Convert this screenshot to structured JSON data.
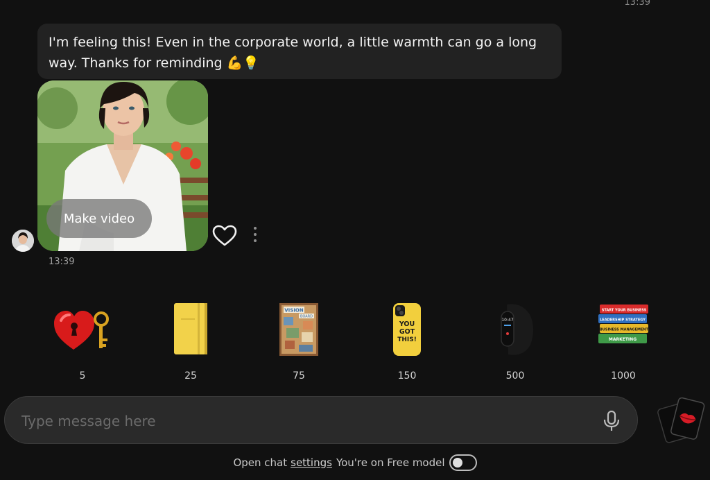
{
  "header": {
    "time": "13:39"
  },
  "message": {
    "text": "I'm feeling this! Even in the corporate world, a little warmth can go a long way. Thanks for reminding 💪💡",
    "make_video_label": "Make video",
    "time": "13:39"
  },
  "gifts": [
    {
      "icon": "heart-key-icon",
      "price": "5"
    },
    {
      "icon": "notebook-icon",
      "price": "25"
    },
    {
      "icon": "vision-board-icon",
      "price": "75"
    },
    {
      "icon": "phone-case-icon",
      "price": "150"
    },
    {
      "icon": "smartwatch-icon",
      "price": "500"
    },
    {
      "icon": "books-icon",
      "price": "1000"
    }
  ],
  "gift_texts": {
    "vision_board_title": "VISION",
    "vision_board_sub": "BOARD",
    "phone_case_text_1": "YOU",
    "phone_case_text_2": "GOT",
    "phone_case_text_3": "THIS!",
    "watch_time": "10:47",
    "book_1": "START YOUR BUSINESS",
    "book_2": "LEADERSHIP STRATEGY",
    "book_3": "BUSINESS MANAGEMENT",
    "book_4": "MARKETING"
  },
  "input": {
    "placeholder": "Type message here"
  },
  "footer": {
    "open_chat": "Open chat",
    "settings": "settings",
    "model_status": "You're on Free model"
  },
  "colors": {
    "background": "#111111",
    "bubble": "#222222",
    "input_bg": "#2a2a2a",
    "heart_red": "#d81b1b",
    "notebook_yellow": "#f2d24a"
  }
}
